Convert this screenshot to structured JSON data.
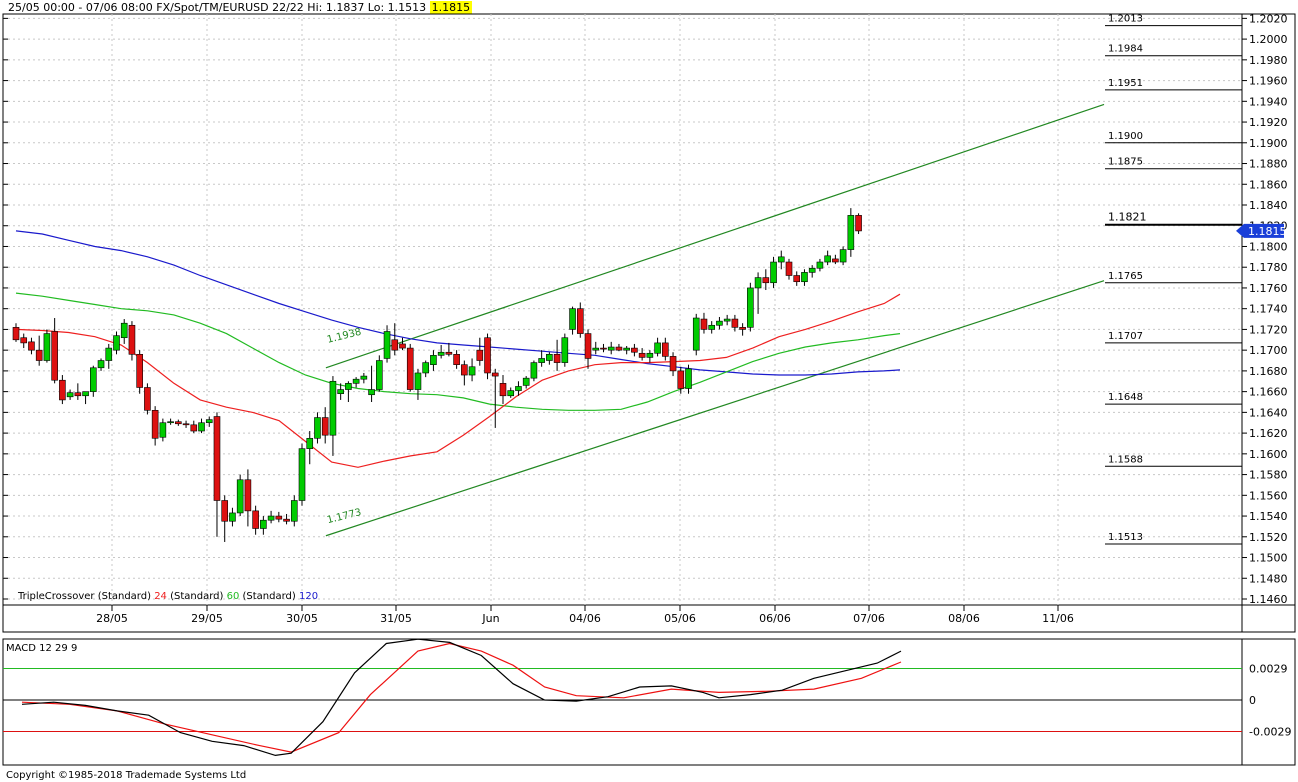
{
  "header": {
    "text": "25/05 00:00 - 07/06 08:00  FX/Spot/TM/EURUSD 22/22  Hi: 1.1837  Lo: 1.1513",
    "last_price": "1.1815"
  },
  "legend": {
    "prefix": "TripleCrossover (Standard)",
    "p1": "24",
    "mid1": " (Standard)",
    "p2": "60",
    "mid2": " (Standard)",
    "p3": "120"
  },
  "macd_label": "MACD 12 29 9",
  "copyright": "Copyright ©1985-2018 Trademade Systems Ltd",
  "colors": {
    "up": "#00cc00",
    "down": "#dd1111",
    "ma24": "#ee2020",
    "ma60": "#22bb22",
    "ma120": "#1a1acc",
    "channel": "#228822",
    "macd": "#000000",
    "signal": "#ee1111",
    "price_tag": "#1a3fd8"
  },
  "chart_data": {
    "type": "candlestick",
    "y_range": [
      1.146,
      1.203
    ],
    "y_ticks": [
      "1.1460",
      "1.1480",
      "1.1500",
      "1.1520",
      "1.1540",
      "1.1560",
      "1.1580",
      "1.1600",
      "1.1620",
      "1.1640",
      "1.1660",
      "1.1680",
      "1.1700",
      "1.1720",
      "1.1740",
      "1.1760",
      "1.1780",
      "1.1800",
      "1.1820",
      "1.1840",
      "1.1860",
      "1.1880",
      "1.1900",
      "1.1920",
      "1.1940",
      "1.1960",
      "1.1980",
      "1.2000",
      "1.2020"
    ],
    "x_labels": [
      "28/05",
      "29/05",
      "30/05",
      "31/05",
      "Jun",
      "04/06",
      "05/06",
      "06/06",
      "07/06",
      "08/06",
      "11/06"
    ],
    "last_price": 1.1815,
    "levels": [
      {
        "label": "1.2013",
        "value": 1.2013
      },
      {
        "label": "1.1984",
        "value": 1.1984
      },
      {
        "label": "1.1951",
        "value": 1.1951
      },
      {
        "label": "1.1900",
        "value": 1.19
      },
      {
        "label": "1.1875",
        "value": 1.1875
      },
      {
        "label": "1.1821",
        "value": 1.1821,
        "bold": true
      },
      {
        "label": "1.1765",
        "value": 1.1765
      },
      {
        "label": "1.1707",
        "value": 1.1707
      },
      {
        "label": "1.1648",
        "value": 1.1648
      },
      {
        "label": "1.1588",
        "value": 1.1588
      },
      {
        "label": "1.1513",
        "value": 1.1513
      }
    ],
    "channel_labels": [
      {
        "text": "1.1938",
        "idx": 30,
        "value": 1.1707
      },
      {
        "text": "1.1773",
        "idx": 30,
        "value": 1.1533
      }
    ],
    "channel": {
      "upper": {
        "i0": 30,
        "v0": 1.1683,
        "i1": 111,
        "v1": 1.1937
      },
      "lower": {
        "i0": 30,
        "v0": 1.1521,
        "i1": 111,
        "v1": 1.1767
      }
    },
    "candles": [
      [
        1.1722,
        1.1726,
        1.1708,
        1.171
      ],
      [
        1.1712,
        1.1716,
        1.1702,
        1.1707
      ],
      [
        1.1708,
        1.1712,
        1.1696,
        1.17
      ],
      [
        1.17,
        1.1714,
        1.1685,
        1.169
      ],
      [
        1.169,
        1.172,
        1.1688,
        1.1716
      ],
      [
        1.1718,
        1.1731,
        1.1668,
        1.1671
      ],
      [
        1.1671,
        1.1676,
        1.1648,
        1.1652
      ],
      [
        1.1655,
        1.1662,
        1.1652,
        1.1659
      ],
      [
        1.1659,
        1.1668,
        1.1652,
        1.1656
      ],
      [
        1.1656,
        1.166,
        1.1648,
        1.166
      ],
      [
        1.166,
        1.1685,
        1.1655,
        1.1683
      ],
      [
        1.1683,
        1.1692,
        1.168,
        1.169
      ],
      [
        1.169,
        1.1706,
        1.1682,
        1.1702
      ],
      [
        1.17,
        1.1718,
        1.1696,
        1.1714
      ],
      [
        1.1712,
        1.173,
        1.1706,
        1.1726
      ],
      [
        1.1724,
        1.1728,
        1.169,
        1.1696
      ],
      [
        1.1696,
        1.17,
        1.1658,
        1.1664
      ],
      [
        1.1664,
        1.1668,
        1.1638,
        1.1642
      ],
      [
        1.1642,
        1.1646,
        1.1608,
        1.1615
      ],
      [
        1.1616,
        1.1634,
        1.1612,
        1.163
      ],
      [
        1.163,
        1.1634,
        1.1628,
        1.1631
      ],
      [
        1.1631,
        1.1633,
        1.1627,
        1.1629
      ],
      [
        1.1629,
        1.1632,
        1.1625,
        1.1628
      ],
      [
        1.1628,
        1.1632,
        1.162,
        1.1622
      ],
      [
        1.1622,
        1.1634,
        1.162,
        1.163
      ],
      [
        1.163,
        1.1636,
        1.1626,
        1.1633
      ],
      [
        1.1636,
        1.164,
        1.152,
        1.1555
      ],
      [
        1.1555,
        1.156,
        1.1515,
        1.1535
      ],
      [
        1.1535,
        1.1548,
        1.153,
        1.1543
      ],
      [
        1.1543,
        1.158,
        1.154,
        1.1575
      ],
      [
        1.1575,
        1.1585,
        1.153,
        1.1545
      ],
      [
        1.1545,
        1.155,
        1.1522,
        1.1528
      ],
      [
        1.1528,
        1.154,
        1.1522,
        1.1536
      ],
      [
        1.1536,
        1.1545,
        1.1533,
        1.154
      ],
      [
        1.154,
        1.1544,
        1.1534,
        1.1537
      ],
      [
        1.1537,
        1.1542,
        1.1532,
        1.1535
      ],
      [
        1.1535,
        1.156,
        1.153,
        1.1555
      ],
      [
        1.1555,
        1.161,
        1.155,
        1.1605
      ],
      [
        1.1605,
        1.1622,
        1.159,
        1.1615
      ],
      [
        1.1615,
        1.164,
        1.161,
        1.1635
      ],
      [
        1.1635,
        1.1645,
        1.161,
        1.1618
      ],
      [
        1.1618,
        1.1675,
        1.1598,
        1.167
      ],
      [
        1.1658,
        1.1668,
        1.1652,
        1.1662
      ],
      [
        1.1662,
        1.167,
        1.165,
        1.1668
      ],
      [
        1.1668,
        1.1674,
        1.1664,
        1.1672
      ],
      [
        1.1672,
        1.1678,
        1.1668,
        1.1675
      ],
      [
        1.1657,
        1.1685,
        1.165,
        1.1662
      ],
      [
        1.1662,
        1.1695,
        1.166,
        1.169
      ],
      [
        1.1692,
        1.1724,
        1.1688,
        1.1718
      ],
      [
        1.171,
        1.1726,
        1.1695,
        1.17
      ],
      [
        1.1706,
        1.1712,
        1.17,
        1.1702
      ],
      [
        1.1702,
        1.1706,
        1.166,
        1.1662
      ],
      [
        1.1662,
        1.1682,
        1.1652,
        1.1678
      ],
      [
        1.1678,
        1.169,
        1.1674,
        1.1688
      ],
      [
        1.1686,
        1.17,
        1.168,
        1.1695
      ],
      [
        1.1695,
        1.1705,
        1.1692,
        1.1698
      ],
      [
        1.1698,
        1.1707,
        1.1694,
        1.1696
      ],
      [
        1.1696,
        1.17,
        1.1682,
        1.1686
      ],
      [
        1.1686,
        1.169,
        1.1666,
        1.1676
      ],
      [
        1.1676,
        1.1692,
        1.167,
        1.1684
      ],
      [
        1.17,
        1.1712,
        1.1685,
        1.169
      ],
      [
        1.1712,
        1.1716,
        1.1672,
        1.1678
      ],
      [
        1.1678,
        1.1682,
        1.1625,
        1.1675
      ],
      [
        1.1668,
        1.1676,
        1.1648,
        1.1656
      ],
      [
        1.1656,
        1.1664,
        1.1654,
        1.1661
      ],
      [
        1.1661,
        1.167,
        1.1656,
        1.1665
      ],
      [
        1.1666,
        1.1675,
        1.1663,
        1.1673
      ],
      [
        1.1673,
        1.169,
        1.167,
        1.1688
      ],
      [
        1.1688,
        1.17,
        1.1684,
        1.1692
      ],
      [
        1.169,
        1.1698,
        1.1686,
        1.1696
      ],
      [
        1.1696,
        1.171,
        1.168,
        1.1688
      ],
      [
        1.1688,
        1.1716,
        1.1684,
        1.1712
      ],
      [
        1.172,
        1.1742,
        1.1715,
        1.174
      ],
      [
        1.174,
        1.1746,
        1.1712,
        1.1716
      ],
      [
        1.1716,
        1.172,
        1.1682,
        1.1692
      ],
      [
        1.17,
        1.1708,
        1.1696,
        1.1702
      ],
      [
        1.1702,
        1.1706,
        1.1698,
        1.1701
      ],
      [
        1.17,
        1.1708,
        1.1696,
        1.1703
      ],
      [
        1.1703,
        1.1706,
        1.1699,
        1.17
      ],
      [
        1.17,
        1.1704,
        1.1696,
        1.1702
      ],
      [
        1.1702,
        1.1706,
        1.1694,
        1.1698
      ],
      [
        1.1697,
        1.1702,
        1.169,
        1.1693
      ],
      [
        1.1693,
        1.17,
        1.1688,
        1.1697
      ],
      [
        1.1697,
        1.1712,
        1.1694,
        1.1707
      ],
      [
        1.1707,
        1.1712,
        1.169,
        1.1694
      ],
      [
        1.1694,
        1.1698,
        1.1675,
        1.168
      ],
      [
        1.168,
        1.1684,
        1.1658,
        1.1663
      ],
      [
        1.1663,
        1.1686,
        1.1658,
        1.1682
      ],
      [
        1.17,
        1.1735,
        1.1695,
        1.1731
      ],
      [
        1.173,
        1.1736,
        1.1716,
        1.172
      ],
      [
        1.172,
        1.1728,
        1.1716,
        1.1724
      ],
      [
        1.1724,
        1.1732,
        1.172,
        1.1728
      ],
      [
        1.1728,
        1.1734,
        1.1724,
        1.173
      ],
      [
        1.173,
        1.1734,
        1.1718,
        1.1722
      ],
      [
        1.1722,
        1.1726,
        1.1714,
        1.172
      ],
      [
        1.1722,
        1.1765,
        1.1718,
        1.176
      ],
      [
        1.176,
        1.1775,
        1.1735,
        1.177
      ],
      [
        1.177,
        1.1778,
        1.1758,
        1.1765
      ],
      [
        1.1765,
        1.179,
        1.176,
        1.1785
      ],
      [
        1.1785,
        1.1796,
        1.1778,
        1.179
      ],
      [
        1.1785,
        1.1788,
        1.1768,
        1.1772
      ],
      [
        1.1772,
        1.1776,
        1.1762,
        1.1766
      ],
      [
        1.1766,
        1.1778,
        1.1762,
        1.1775
      ],
      [
        1.1775,
        1.1782,
        1.177,
        1.1779
      ],
      [
        1.1779,
        1.1788,
        1.1776,
        1.1785
      ],
      [
        1.1785,
        1.1796,
        1.1782,
        1.1791
      ],
      [
        1.1788,
        1.1792,
        1.1783,
        1.1785
      ],
      [
        1.1785,
        1.18,
        1.1782,
        1.1797
      ],
      [
        1.1797,
        1.1837,
        1.179,
        1.183
      ],
      [
        1.183,
        1.1832,
        1.1812,
        1.1815
      ]
    ],
    "ma_120": [
      [
        0,
        1.1815
      ],
      [
        5,
        1.1812
      ],
      [
        10,
        1.1806
      ],
      [
        15,
        1.18
      ],
      [
        20,
        1.1796
      ],
      [
        25,
        1.179
      ],
      [
        30,
        1.1782
      ],
      [
        35,
        1.1772
      ],
      [
        40,
        1.1763
      ],
      [
        45,
        1.1754
      ],
      [
        50,
        1.1745
      ],
      [
        55,
        1.1737
      ],
      [
        60,
        1.1729
      ],
      [
        65,
        1.1722
      ],
      [
        70,
        1.1716
      ],
      [
        75,
        1.1711
      ],
      [
        80,
        1.1707
      ],
      [
        85,
        1.1705
      ],
      [
        90,
        1.1703
      ],
      [
        95,
        1.1701
      ],
      [
        100,
        1.1699
      ],
      [
        105,
        1.1697
      ],
      [
        110,
        1.1695
      ],
      [
        115,
        1.1691
      ],
      [
        120,
        1.1687
      ],
      [
        125,
        1.1684
      ],
      [
        130,
        1.1681
      ],
      [
        135,
        1.1679
      ],
      [
        140,
        1.1677
      ],
      [
        145,
        1.1676
      ],
      [
        150,
        1.1676
      ],
      [
        155,
        1.1677
      ],
      [
        160,
        1.1679
      ],
      [
        165,
        1.168
      ],
      [
        168,
        1.1681
      ]
    ],
    "ma_60": [
      [
        0,
        1.1755
      ],
      [
        5,
        1.1752
      ],
      [
        10,
        1.1748
      ],
      [
        15,
        1.1744
      ],
      [
        20,
        1.174
      ],
      [
        25,
        1.1738
      ],
      [
        30,
        1.1734
      ],
      [
        35,
        1.1726
      ],
      [
        40,
        1.1716
      ],
      [
        45,
        1.1702
      ],
      [
        50,
        1.1688
      ],
      [
        55,
        1.1676
      ],
      [
        60,
        1.1668
      ],
      [
        65,
        1.1663
      ],
      [
        70,
        1.166
      ],
      [
        75,
        1.1658
      ],
      [
        80,
        1.1657
      ],
      [
        85,
        1.1654
      ],
      [
        90,
        1.1648
      ],
      [
        95,
        1.1645
      ],
      [
        100,
        1.1643
      ],
      [
        105,
        1.1642
      ],
      [
        110,
        1.1642
      ],
      [
        115,
        1.1643
      ],
      [
        120,
        1.165
      ],
      [
        125,
        1.166
      ],
      [
        130,
        1.1669
      ],
      [
        135,
        1.1679
      ],
      [
        140,
        1.1689
      ],
      [
        145,
        1.1697
      ],
      [
        150,
        1.1703
      ],
      [
        155,
        1.1707
      ],
      [
        160,
        1.171
      ],
      [
        165,
        1.1714
      ],
      [
        168,
        1.1716
      ]
    ],
    "ma_24": [
      [
        0,
        1.172
      ],
      [
        5,
        1.1719
      ],
      [
        10,
        1.1717
      ],
      [
        15,
        1.1713
      ],
      [
        20,
        1.1705
      ],
      [
        25,
        1.1688
      ],
      [
        30,
        1.1668
      ],
      [
        35,
        1.1652
      ],
      [
        40,
        1.1645
      ],
      [
        45,
        1.164
      ],
      [
        50,
        1.1632
      ],
      [
        55,
        1.1612
      ],
      [
        60,
        1.1592
      ],
      [
        65,
        1.1587
      ],
      [
        70,
        1.1593
      ],
      [
        75,
        1.1598
      ],
      [
        80,
        1.1602
      ],
      [
        85,
        1.1618
      ],
      [
        90,
        1.1636
      ],
      [
        95,
        1.1655
      ],
      [
        100,
        1.1671
      ],
      [
        105,
        1.168
      ],
      [
        110,
        1.1686
      ],
      [
        115,
        1.1688
      ],
      [
        120,
        1.1688
      ],
      [
        125,
        1.1689
      ],
      [
        130,
        1.169
      ],
      [
        135,
        1.1693
      ],
      [
        140,
        1.1702
      ],
      [
        145,
        1.1713
      ],
      [
        150,
        1.172
      ],
      [
        155,
        1.1728
      ],
      [
        160,
        1.1737
      ],
      [
        165,
        1.1745
      ],
      [
        168,
        1.1754
      ]
    ],
    "macd": {
      "ticks": [
        "0.0029",
        "0",
        "-0.0029"
      ],
      "y_range": [
        -0.0058,
        0.0058
      ],
      "macd_line": [
        [
          0,
          -0.0004
        ],
        [
          4,
          -0.0002
        ],
        [
          8,
          -0.0005
        ],
        [
          12,
          -0.001
        ],
        [
          16,
          -0.0014
        ],
        [
          20,
          -0.003
        ],
        [
          24,
          -0.0038
        ],
        [
          28,
          -0.0042
        ],
        [
          32,
          -0.0051
        ],
        [
          34,
          -0.0049
        ],
        [
          38,
          -0.002
        ],
        [
          42,
          0.0025
        ],
        [
          46,
          0.0052
        ],
        [
          50,
          0.0056
        ],
        [
          54,
          0.0053
        ],
        [
          58,
          0.0041
        ],
        [
          62,
          0.0015
        ],
        [
          66,
          0.0
        ],
        [
          70,
          -0.0001
        ],
        [
          74,
          0.0003
        ],
        [
          78,
          0.0012
        ],
        [
          82,
          0.0013
        ],
        [
          86,
          0.0007
        ],
        [
          88,
          0.0002
        ],
        [
          92,
          0.0005
        ],
        [
          96,
          0.0009
        ],
        [
          100,
          0.002
        ],
        [
          104,
          0.0027
        ],
        [
          108,
          0.0034
        ],
        [
          111,
          0.0045
        ]
      ],
      "signal_line": [
        [
          0,
          -0.0002
        ],
        [
          6,
          -0.0004
        ],
        [
          12,
          -0.001
        ],
        [
          18,
          -0.0022
        ],
        [
          24,
          -0.0032
        ],
        [
          30,
          -0.0042
        ],
        [
          34,
          -0.0048
        ],
        [
          40,
          -0.003
        ],
        [
          44,
          0.0005
        ],
        [
          50,
          0.0045
        ],
        [
          54,
          0.0052
        ],
        [
          58,
          0.0045
        ],
        [
          62,
          0.0032
        ],
        [
          66,
          0.0012
        ],
        [
          70,
          0.0004
        ],
        [
          76,
          0.0002
        ],
        [
          82,
          0.001
        ],
        [
          88,
          0.0007
        ],
        [
          94,
          0.0008
        ],
        [
          100,
          0.001
        ],
        [
          106,
          0.002
        ],
        [
          111,
          0.0035
        ]
      ]
    }
  }
}
